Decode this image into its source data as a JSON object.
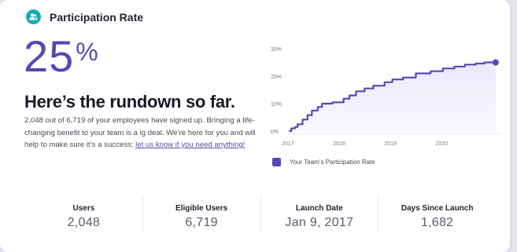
{
  "header": {
    "title": "Participation Rate",
    "icon": "users-icon"
  },
  "hero": {
    "percent_value": "25",
    "percent_sign": "%",
    "headline": "Here’s the rundown so far.",
    "body_text": "2,048 out of 6,719 of your employees have signed up. Bringing a life-changing benefit to your team is a ig deal. We’re here for you and will help to make sure it’s a success; ",
    "body_link": "let us know if you need anything!"
  },
  "chart_data": {
    "type": "line",
    "legend": [
      "Your Team’s Participation Rate"
    ],
    "legend_position": "bottom-left",
    "x_ticks": [
      "2017",
      "2018",
      "2019",
      "2020"
    ],
    "y_ticks": [
      "0%",
      "10%",
      "20%",
      "30%"
    ],
    "ylim": [
      0,
      30
    ],
    "grid": false,
    "series": [
      {
        "name": "Your Team’s Participation Rate",
        "color": "#5a46b4",
        "points": [
          [
            "2017-01-09",
            0.0
          ],
          [
            "2017-01-25",
            1.0
          ],
          [
            "2017-02-20",
            1.5
          ],
          [
            "2017-03-10",
            2.5
          ],
          [
            "2017-04-15",
            4.2
          ],
          [
            "2017-05-20",
            5.8
          ],
          [
            "2017-06-20",
            7.5
          ],
          [
            "2017-08-01",
            8.8
          ],
          [
            "2017-09-01",
            10.0
          ],
          [
            "2017-11-15",
            10.5
          ],
          [
            "2018-02-01",
            11.8
          ],
          [
            "2018-03-15",
            13.0
          ],
          [
            "2018-05-01",
            14.5
          ],
          [
            "2018-07-01",
            15.5
          ],
          [
            "2018-09-01",
            16.5
          ],
          [
            "2018-11-20",
            17.8
          ],
          [
            "2019-01-15",
            18.8
          ],
          [
            "2019-04-01",
            19.5
          ],
          [
            "2019-07-01",
            21.0
          ],
          [
            "2019-10-15",
            21.8
          ],
          [
            "2020-01-10",
            22.8
          ],
          [
            "2020-04-01",
            23.5
          ],
          [
            "2020-06-15",
            24.2
          ],
          [
            "2020-09-01",
            24.6
          ],
          [
            "2020-11-01",
            25.0
          ],
          [
            "2021-01-20",
            25.0
          ]
        ]
      }
    ]
  },
  "stats": [
    {
      "label": "Users",
      "value": "2,048"
    },
    {
      "label": "Eligible Users",
      "value": "6,719"
    },
    {
      "label": "Launch Date",
      "value": "Jan 9, 2017"
    },
    {
      "label": "Days Since Launch",
      "value": "1,682"
    }
  ]
}
